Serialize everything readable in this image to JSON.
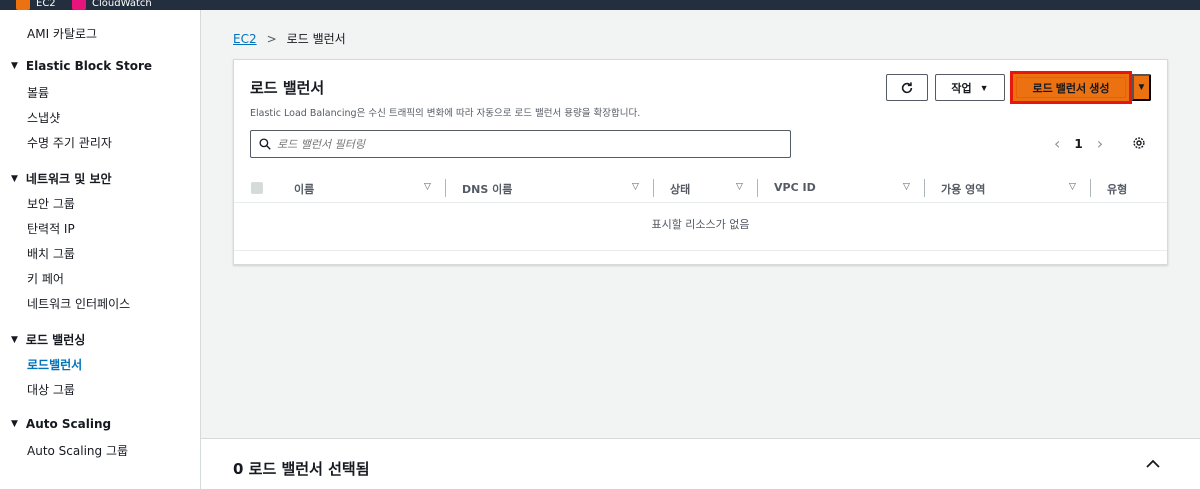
{
  "topbar": {
    "items": [
      {
        "label": "EC2",
        "color": "#ec7211"
      },
      {
        "label": "CloudWatch",
        "color": "#e7157b"
      }
    ]
  },
  "sidebar": {
    "items": [
      {
        "type": "item",
        "label": "AMI 카탈로그"
      },
      {
        "type": "group",
        "label": "Elastic Block Store"
      },
      {
        "type": "item",
        "label": "볼륨"
      },
      {
        "type": "item",
        "label": "스냅샷"
      },
      {
        "type": "item",
        "label": "수명 주기 관리자"
      },
      {
        "type": "group",
        "label": "네트워크 및 보안"
      },
      {
        "type": "item",
        "label": "보안 그룹"
      },
      {
        "type": "item",
        "label": "탄력적 IP"
      },
      {
        "type": "item",
        "label": "배치 그룹"
      },
      {
        "type": "item",
        "label": "키 페어"
      },
      {
        "type": "item",
        "label": "네트워크 인터페이스"
      },
      {
        "type": "group",
        "label": "로드 밸런싱"
      },
      {
        "type": "item",
        "label": "로드밸런서",
        "active": true
      },
      {
        "type": "item",
        "label": "대상 그룹"
      },
      {
        "type": "group",
        "label": "Auto Scaling"
      },
      {
        "type": "item",
        "label": "Auto Scaling 그룹"
      }
    ]
  },
  "breadcrumb": {
    "root": "EC2",
    "current": "로드 밸런서"
  },
  "panel": {
    "title": "로드 밸런서",
    "description": "Elastic Load Balancing은 수신 트래픽의 변화에 따라 자동으로 로드 밸런서 용량을 확장합니다.",
    "actions_label": "작업",
    "create_label": "로드 밸런서 생성",
    "search_placeholder": "로드 밸런서 필터링",
    "page_number": "1",
    "columns": [
      "이름",
      "DNS 이름",
      "상태",
      "VPC ID",
      "가용 영역",
      "유형"
    ],
    "empty_message": "표시할 리소스가 없음"
  },
  "split_panel": {
    "title": "0 로드 밸런서 선택됨"
  },
  "colors": {
    "accent": "#ec7211",
    "highlight": "#e8170c",
    "link": "#0073bb"
  }
}
